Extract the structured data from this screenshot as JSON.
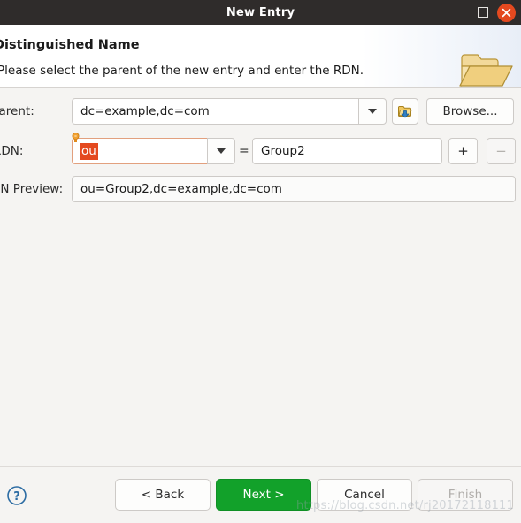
{
  "window": {
    "title": "New Entry",
    "maximize_label": "Maximize",
    "close_label": "Close"
  },
  "header": {
    "title": "Distinguished Name",
    "subtitle": "Please select the parent of the new entry and enter the RDN.",
    "icon": "open-folder-icon"
  },
  "form": {
    "parent": {
      "label": "Parent:",
      "value": "dc=example,dc=com",
      "dropdown_icon": "chevron-down-icon",
      "history_button_icon": "folder-up-icon",
      "browse_label": "Browse..."
    },
    "rdn": {
      "label": "RDN:",
      "type_value": "ou",
      "type_selected": true,
      "dropdown_icon": "chevron-down-icon",
      "equals": "=",
      "value": "Group2",
      "add_label": "+",
      "remove_label": "−",
      "hint_icon": "lightbulb-icon"
    },
    "dn_preview": {
      "label": "DN Preview:",
      "value": "ou=Group2,dc=example,dc=com"
    }
  },
  "footer": {
    "help_icon": "help-circle-icon",
    "back_label": "< Back",
    "next_label": "Next >",
    "cancel_label": "Cancel",
    "finish_label": "Finish"
  },
  "watermark": {
    "text": "https://blog.csdn.net/rj20172118111"
  },
  "colors": {
    "titlebar": "#2f2c2b",
    "close_button": "#e4491f",
    "selection": "#e4491f",
    "default_button": "#12a12a",
    "content_background": "#f5f4f2"
  }
}
